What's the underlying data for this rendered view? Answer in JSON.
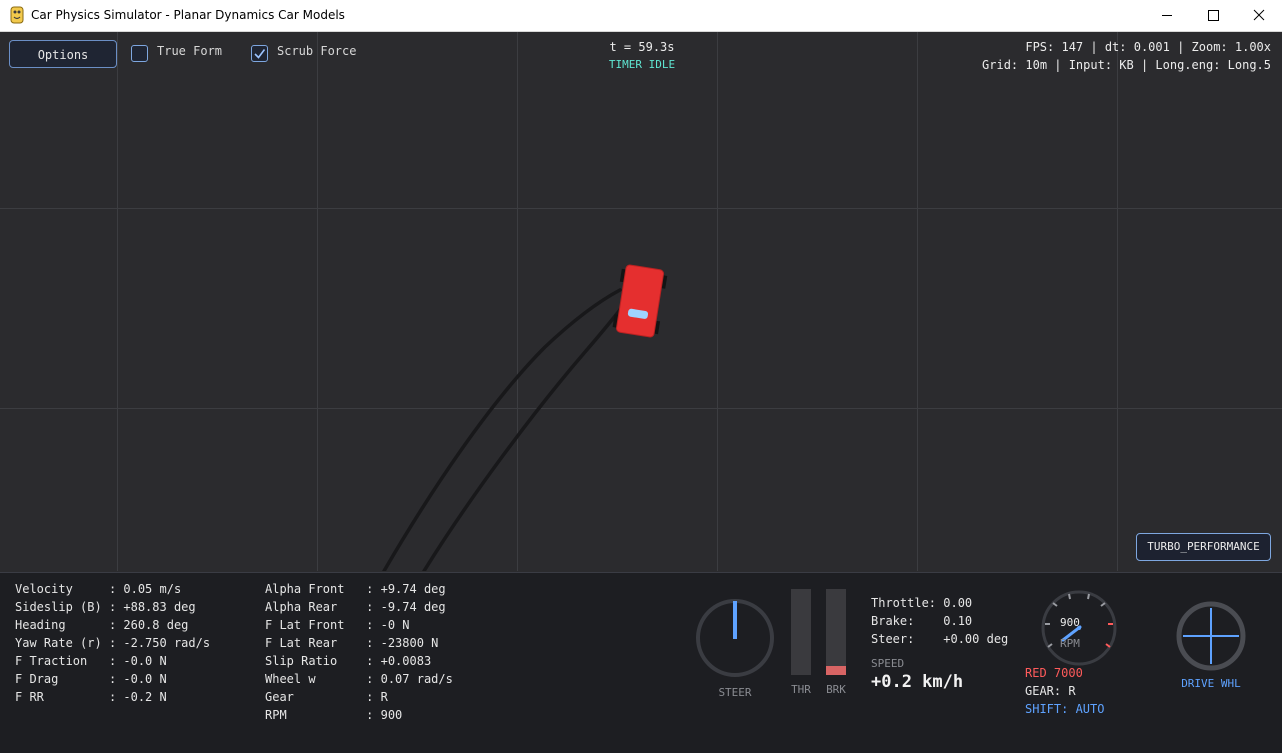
{
  "window": {
    "title": "Car Physics Simulator - Planar Dynamics Car Models"
  },
  "toolbar": {
    "options_label": "Options",
    "true_form": {
      "label": "True Form",
      "checked": false
    },
    "scrub_force": {
      "label": "Scrub Force",
      "checked": true
    }
  },
  "timer": {
    "time": "t = 59.3s",
    "status": "TIMER IDLE"
  },
  "hud": {
    "line1": "FPS: 147 | dt: 0.001 | Zoom: 1.00x",
    "line2": "Grid: 10m | Input: KB | Long.eng: Long.5"
  },
  "preset": {
    "label": "TURBO_PERFORMANCE"
  },
  "telemetry_left": [
    {
      "label": "Velocity    ",
      "value": ": 0.05 m/s"
    },
    {
      "label": "Sideslip (B)",
      "value": ": +88.83 deg"
    },
    {
      "label": "Heading     ",
      "value": ": 260.8 deg"
    },
    {
      "label": "Yaw Rate (r)",
      "value": ": -2.750 rad/s"
    },
    {
      "label": "F Traction  ",
      "value": ": -0.0 N"
    },
    {
      "label": "F Drag      ",
      "value": ": -0.0 N"
    },
    {
      "label": "F RR        ",
      "value": ": -0.2 N"
    }
  ],
  "telemetry_right": [
    {
      "label": "Alpha Front  ",
      "value": ": +9.74 deg"
    },
    {
      "label": "Alpha Rear   ",
      "value": ": -9.74 deg"
    },
    {
      "label": "F Lat Front  ",
      "value": ": -0 N"
    },
    {
      "label": "F Lat Rear   ",
      "value": ": -23800 N"
    },
    {
      "label": "Slip Ratio   ",
      "value": ": +0.0083"
    },
    {
      "label": "Wheel w      ",
      "value": ": 0.07 rad/s"
    },
    {
      "label": "Gear         ",
      "value": ": R"
    },
    {
      "label": "RPM          ",
      "value": ": 900"
    }
  ],
  "gauges": {
    "steer_label": "STEER",
    "thr_label": "THR",
    "brk_label": "BRK",
    "throttle_level": 0.0,
    "brake_level": 0.1
  },
  "inputs": {
    "throttle": "Throttle: 0.00",
    "brake": "Brake:    0.10",
    "steer": "Steer:    +0.00 deg"
  },
  "speed": {
    "label": "SPEED",
    "value": "+0.2 km/h"
  },
  "tach": {
    "value": "900",
    "unit": "RPM",
    "redline": "RED 7000",
    "gear": "GEAR: R",
    "shift": "SHIFT: AUTO"
  },
  "wheel": {
    "label": "DRIVE WHL"
  },
  "colors": {
    "accent": "#5ea2ff",
    "timer": "#5fe6d2",
    "car": "#e52f2f",
    "redline": "#ff5b5b",
    "brake_bar": "#d86464"
  }
}
